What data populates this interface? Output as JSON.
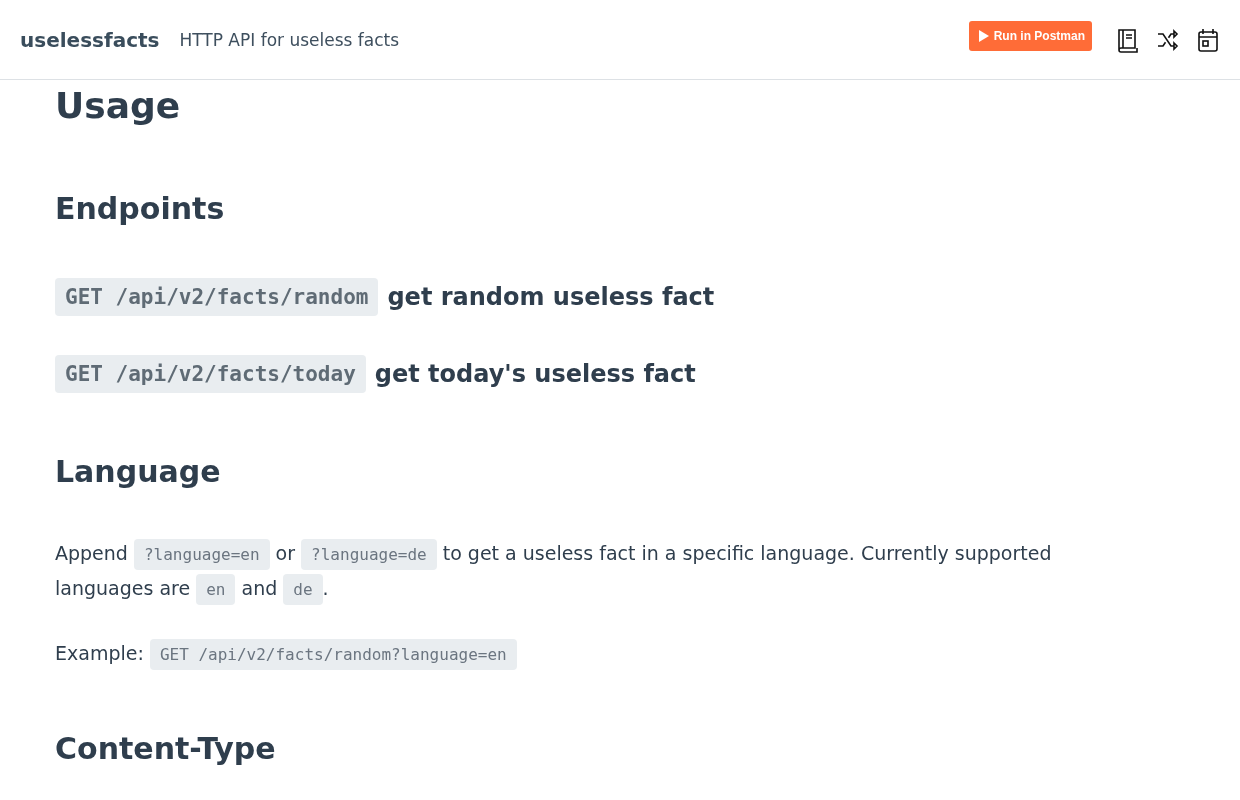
{
  "header": {
    "brand": "uselessfacts",
    "tagline": "HTTP API for useless facts",
    "run_button": "Run in Postman"
  },
  "title": "Usage",
  "sections": [
    {
      "heading": "Endpoints",
      "blocks": [
        {
          "kind": "endpoint",
          "code": "GET /api/v2/facts/random",
          "description": "get random useless fact"
        },
        {
          "kind": "endpoint",
          "code": "GET /api/v2/facts/today",
          "description": "get today's useless fact"
        }
      ]
    },
    {
      "heading": "Language",
      "blocks": [
        {
          "kind": "paragraph",
          "segments": [
            {
              "kind": "text",
              "text": "Append"
            },
            {
              "kind": "code",
              "text": "?language=en"
            },
            {
              "kind": "text",
              "text": "or"
            },
            {
              "kind": "code",
              "text": "?language=de"
            },
            {
              "kind": "text",
              "text": "to get a useless fact in a specific language. Currently supported"
            },
            {
              "kind": "text",
              "text": "languages are"
            },
            {
              "kind": "code",
              "text": "en"
            },
            {
              "kind": "text",
              "text": "and"
            },
            {
              "kind": "code",
              "text": "de"
            },
            {
              "kind": "text",
              "text": "."
            }
          ]
        },
        {
          "kind": "paragraph",
          "segments": [
            {
              "kind": "text",
              "text": "Example:"
            },
            {
              "kind": "code",
              "text": "GET /api/v2/facts/random?language=en"
            }
          ]
        }
      ]
    },
    {
      "heading": "Content-Type"
    }
  ]
}
